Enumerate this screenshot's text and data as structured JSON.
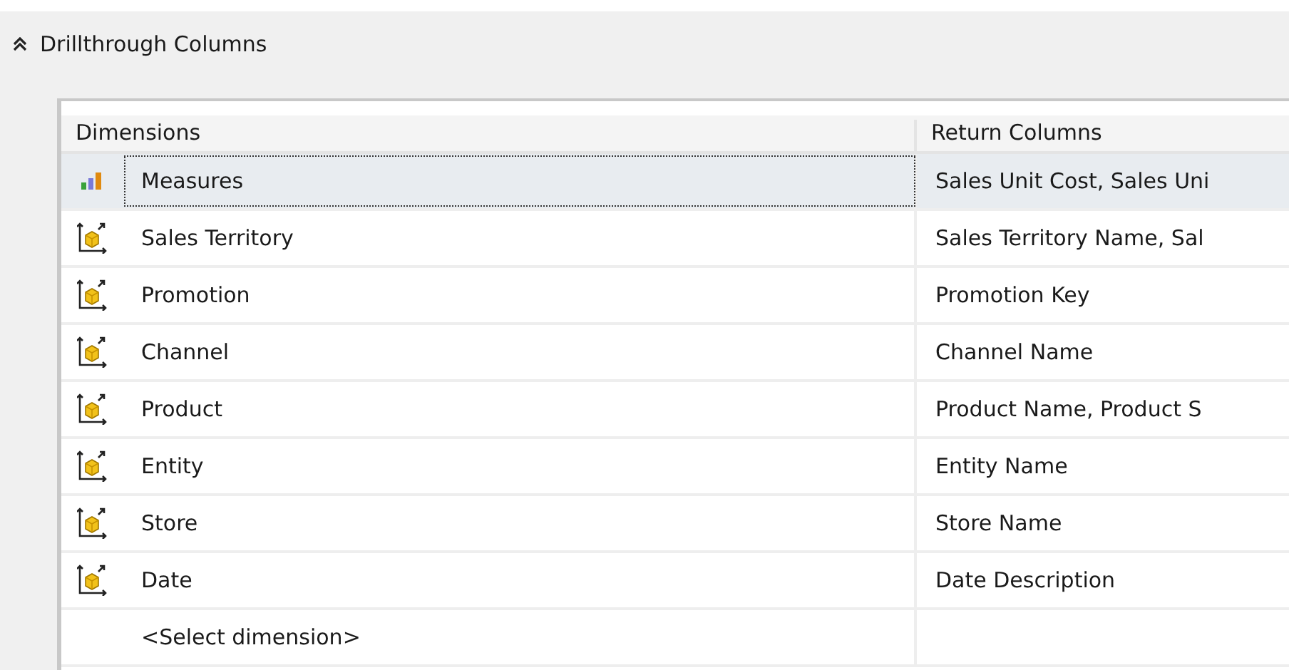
{
  "section": {
    "title": "Drillthrough Columns",
    "expanded": true
  },
  "table": {
    "columns": [
      "Dimensions",
      "Return Columns"
    ],
    "rows": [
      {
        "kind": "measures",
        "dimension": "Measures",
        "return_columns": "Sales Unit Cost, Sales Uni",
        "selected": true
      },
      {
        "kind": "dimension",
        "dimension": "Sales Territory",
        "return_columns": "Sales Territory Name, Sal",
        "selected": false
      },
      {
        "kind": "dimension",
        "dimension": "Promotion",
        "return_columns": "Promotion Key",
        "selected": false
      },
      {
        "kind": "dimension",
        "dimension": "Channel",
        "return_columns": "Channel Name",
        "selected": false
      },
      {
        "kind": "dimension",
        "dimension": "Product",
        "return_columns": "Product Name, Product S",
        "selected": false
      },
      {
        "kind": "dimension",
        "dimension": "Entity",
        "return_columns": "Entity Name",
        "selected": false
      },
      {
        "kind": "dimension",
        "dimension": "Store",
        "return_columns": "Store Name",
        "selected": false
      },
      {
        "kind": "dimension",
        "dimension": "Date",
        "return_columns": "Date Description",
        "selected": false
      }
    ],
    "new_row": {
      "placeholder": "<Select dimension>"
    }
  }
}
